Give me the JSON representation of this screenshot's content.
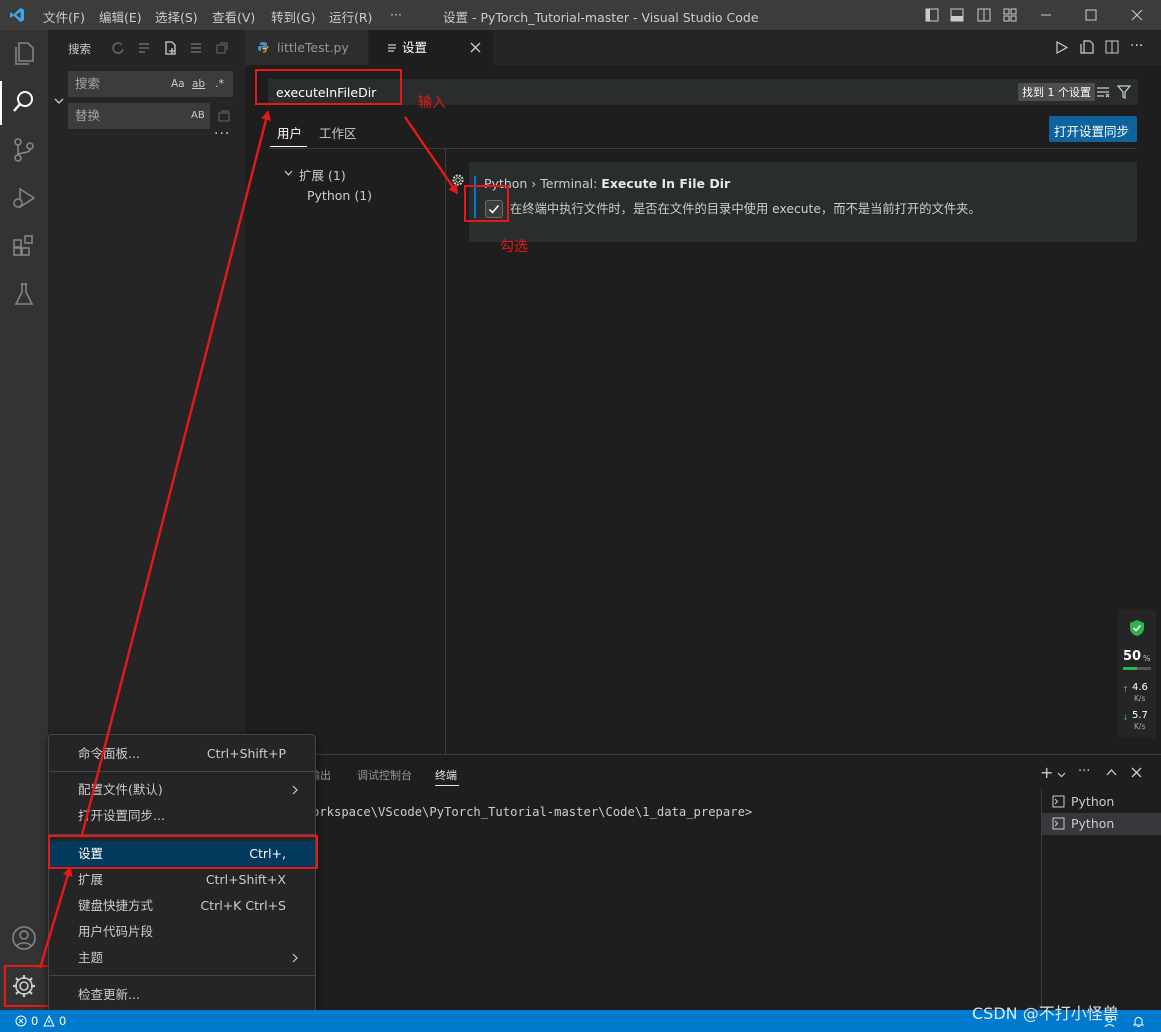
{
  "titlebar": {
    "menus": [
      "文件(F)",
      "编辑(E)",
      "选择(S)",
      "查看(V)",
      "转到(G)",
      "运行(R)",
      "···"
    ],
    "window_title": "设置 - PyTorch_Tutorial-master - Visual Studio Code"
  },
  "sidebar": {
    "title": "搜索",
    "search_placeholder": "搜索",
    "replace_placeholder": "替换",
    "search_opts": [
      "Aa",
      "ab",
      ".*"
    ],
    "replace_opt": "AB"
  },
  "tabs": [
    {
      "label": "littleTest.py",
      "active": false
    },
    {
      "label": "设置",
      "active": true
    }
  ],
  "settings": {
    "search_value": "executeInFileDir",
    "found_text": "找到 1 个设置",
    "scope_tabs": [
      "用户",
      "工作区"
    ],
    "sync_button": "打开设置同步",
    "toc": [
      {
        "label": "扩展",
        "count": "(1)"
      },
      {
        "label": "Python",
        "count": "(1)"
      }
    ],
    "item": {
      "category": "Python › Terminal: ",
      "name": "Execute In File Dir",
      "description": "在终端中执行文件时，是否在文件的目录中使用 execute，而不是当前打开的文件夹。",
      "checked": true
    }
  },
  "annotations": {
    "input": "输入",
    "check": "勾选"
  },
  "widget": {
    "percent": "50",
    "percent_unit": "%",
    "up": "4.6",
    "up_unit": "K/s",
    "down": "5.7",
    "down_unit": "K/s"
  },
  "panel": {
    "tabs": [
      "输出",
      "调试控制台",
      "终端"
    ],
    "active_tab": "终端",
    "terminal_line": "orkspace\\VScode\\PyTorch_Tutorial-master\\Code\\1_data_prepare>",
    "terminals": [
      "Python",
      "Python"
    ]
  },
  "context_menu": {
    "items": [
      {
        "label": "命令面板...",
        "key": "Ctrl+Shift+P"
      },
      {
        "label": "配置文件(默认)",
        "key": "",
        "submenu": true
      },
      {
        "label": "打开设置同步...",
        "key": ""
      },
      {
        "label": "设置",
        "key": "Ctrl+,",
        "highlighted": true
      },
      {
        "label": "扩展",
        "key": "Ctrl+Shift+X"
      },
      {
        "label": "键盘快捷方式",
        "key": "Ctrl+K Ctrl+S"
      },
      {
        "label": "用户代码片段",
        "key": ""
      },
      {
        "label": "主题",
        "key": "",
        "submenu": true
      },
      {
        "label": "检查更新...",
        "key": ""
      }
    ]
  },
  "statusbar": {
    "errors": "0",
    "warnings": "0"
  },
  "watermark": "CSDN @不打小怪兽",
  "colors": {
    "accent": "#007acc",
    "annotation_red": "#e51919",
    "highlight": "#04395e",
    "sync_button": "#0e639c"
  }
}
